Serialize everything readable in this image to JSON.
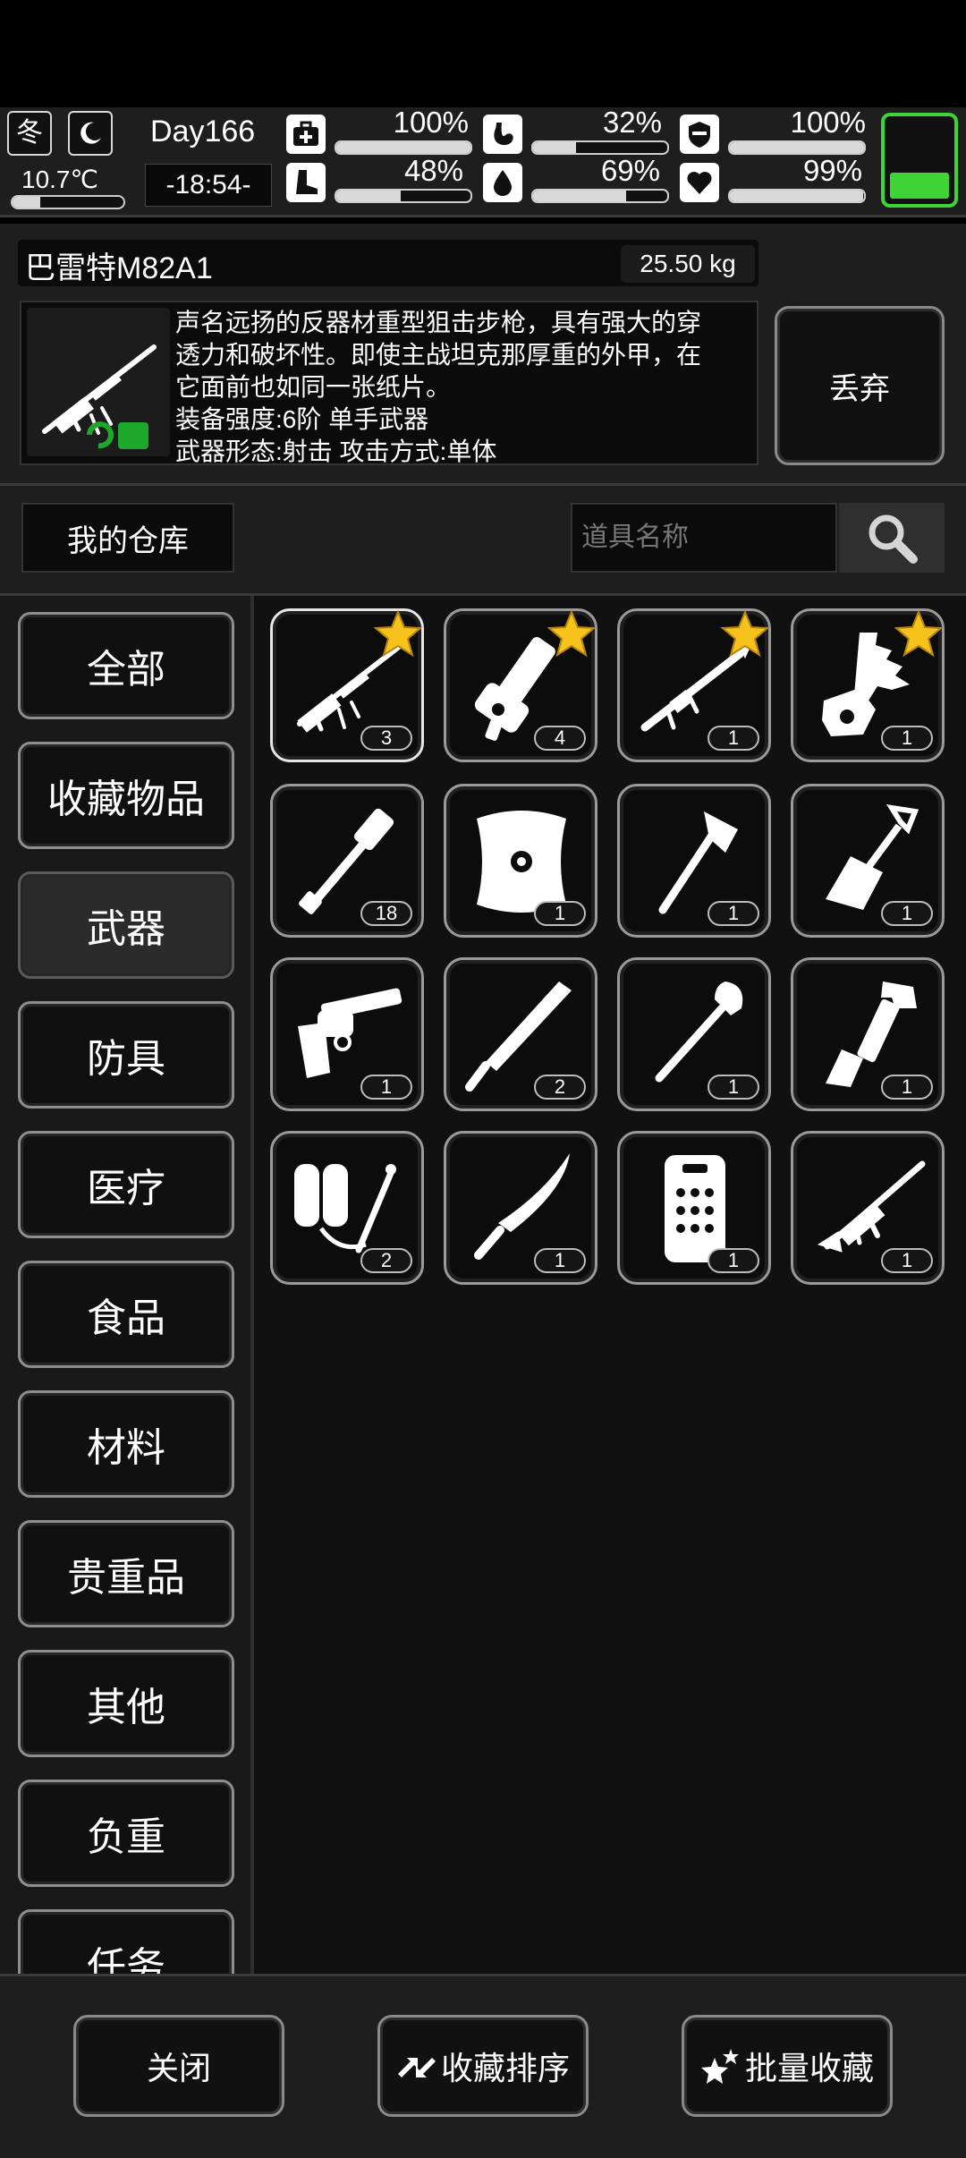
{
  "hud": {
    "season": "冬",
    "moon_icon": "crescent-moon-icon",
    "temperature": "10.7℃",
    "temperature_level": 0.25,
    "day": "Day166",
    "time": "-18:54-",
    "stats": [
      {
        "icon": "medkit-icon",
        "value": "100%",
        "level": 1.0
      },
      {
        "icon": "stomach-icon",
        "value": "32%",
        "level": 0.32
      },
      {
        "icon": "shield-icon",
        "value": "100%",
        "level": 1.0
      },
      {
        "icon": "foot-icon",
        "value": "48%",
        "level": 0.48
      },
      {
        "icon": "water-drop-icon",
        "value": "69%",
        "level": 0.69
      },
      {
        "icon": "heart-icon",
        "value": "99%",
        "level": 0.99
      }
    ],
    "battery_level": 0.3,
    "battery_color": "#3ed436"
  },
  "item": {
    "name": "巴雷特M82A1",
    "weight": "25.50 kg",
    "description_lines": [
      "声名远扬的反器材重型狙击步枪，具有强大的穿",
      "透力和破坏性。即使主战坦克那厚重的外甲，在",
      "它面前也如同一张纸片。"
    ],
    "strength": "装备强度:6阶 单手武器",
    "form": "武器形态:射击 攻击方式:单体",
    "discard_label": "丢弃"
  },
  "storage": {
    "label": "我的仓库",
    "search_placeholder": "道具名称"
  },
  "categories": [
    {
      "label": "全部",
      "active": false
    },
    {
      "label": "收藏物品",
      "active": false
    },
    {
      "label": "武器",
      "active": true
    },
    {
      "label": "防具",
      "active": false
    },
    {
      "label": "医疗",
      "active": false
    },
    {
      "label": "食品",
      "active": false
    },
    {
      "label": "材料",
      "active": false
    },
    {
      "label": "贵重品",
      "active": false
    },
    {
      "label": "其他",
      "active": false
    },
    {
      "label": "负重",
      "active": false
    },
    {
      "label": "任务",
      "active": false
    }
  ],
  "items": [
    {
      "icon": "sniper-rifle-icon",
      "count": "3",
      "favorite": true
    },
    {
      "icon": "grenade-launcher-icon",
      "count": "4",
      "favorite": true
    },
    {
      "icon": "rocket-launcher-icon",
      "count": "1",
      "favorite": true
    },
    {
      "icon": "chainsaw-icon",
      "count": "1",
      "favorite": true
    },
    {
      "icon": "stick-grenade-icon",
      "count": "18",
      "favorite": false
    },
    {
      "icon": "round-shield-icon",
      "count": "1",
      "favorite": false
    },
    {
      "icon": "axe-icon",
      "count": "1",
      "favorite": false
    },
    {
      "icon": "folding-shovel-icon",
      "count": "1",
      "favorite": false
    },
    {
      "icon": "revolver-icon",
      "count": "1",
      "favorite": false
    },
    {
      "icon": "machete-icon",
      "count": "2",
      "favorite": false
    },
    {
      "icon": "shovel-icon",
      "count": "1",
      "favorite": false
    },
    {
      "icon": "pipe-wrench-icon",
      "count": "1",
      "favorite": false
    },
    {
      "icon": "flamethrower-icon",
      "count": "2",
      "favorite": false
    },
    {
      "icon": "curved-knife-icon",
      "count": "1",
      "favorite": false
    },
    {
      "icon": "riot-shield-icon",
      "count": "1",
      "favorite": false
    },
    {
      "icon": "assault-rifle-icon",
      "count": "1",
      "favorite": false
    }
  ],
  "bottom": {
    "close_label": "关闭",
    "sort_label": "收藏排序",
    "batch_label": "批量收藏"
  }
}
